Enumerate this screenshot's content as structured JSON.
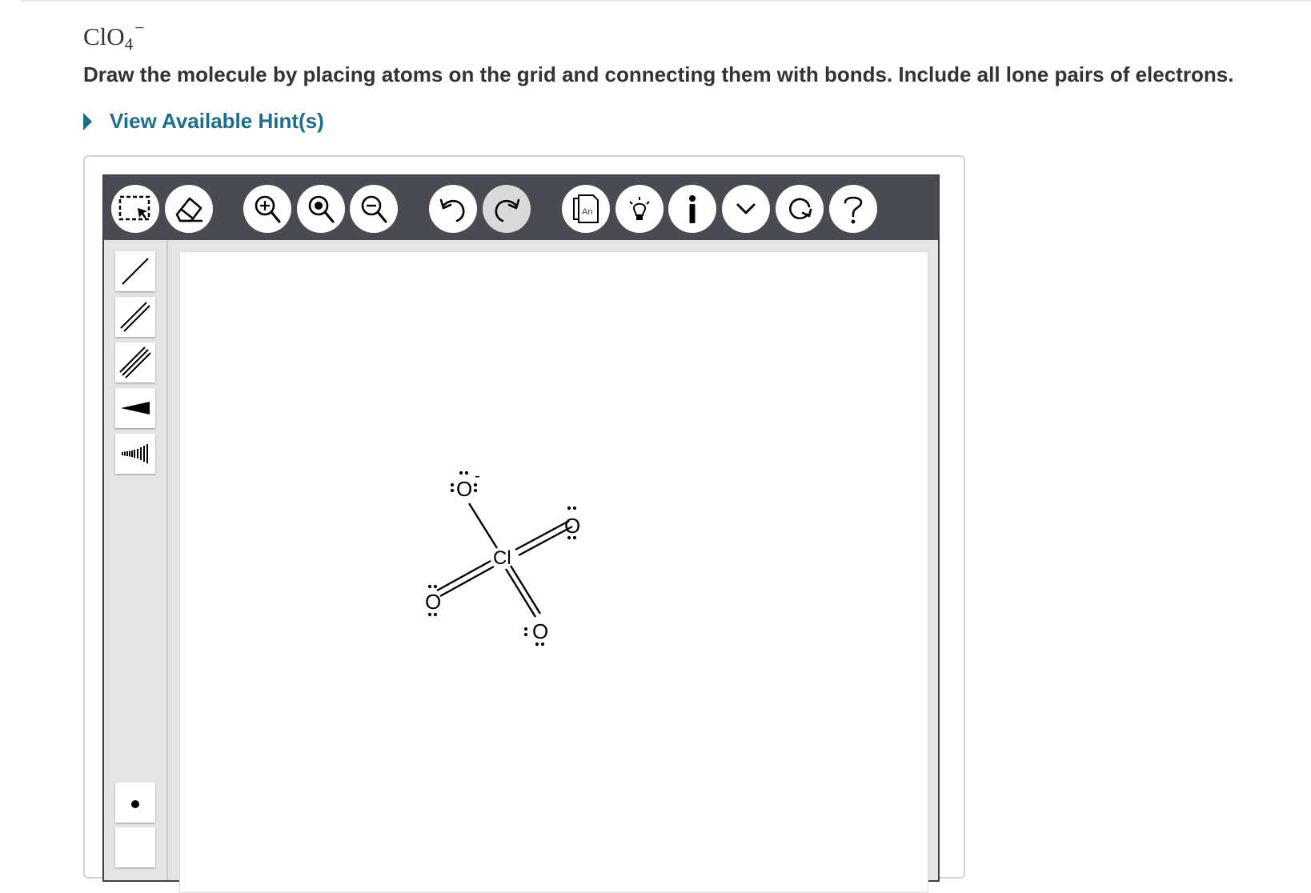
{
  "problem": {
    "formula_base": "ClO",
    "formula_subscript": "4",
    "formula_charge": "−",
    "instructions": "Draw the molecule by placing atoms on the grid and connecting them with bonds. Include all lone pairs of electrons.",
    "hint_link": "View Available Hint(s)"
  },
  "toolbar": {
    "buttons": [
      {
        "name": "marquee-select-icon",
        "enabled": true
      },
      {
        "name": "eraser-icon",
        "enabled": true
      },
      {
        "name": "zoom-in-icon",
        "enabled": true
      },
      {
        "name": "zoom-reset-icon",
        "enabled": true
      },
      {
        "name": "zoom-out-icon",
        "enabled": true
      },
      {
        "name": "undo-icon",
        "enabled": true
      },
      {
        "name": "redo-icon",
        "enabled": false
      },
      {
        "name": "template-icon",
        "enabled": true
      },
      {
        "name": "lightbulb-icon",
        "enabled": true
      },
      {
        "name": "info-icon",
        "enabled": true
      },
      {
        "name": "chevron-down-icon",
        "enabled": true
      },
      {
        "name": "reset-icon",
        "enabled": true
      },
      {
        "name": "help-icon",
        "enabled": true
      }
    ],
    "template_icon_text": "An"
  },
  "sidebar_tools": [
    "single-bond-icon",
    "double-bond-icon",
    "triple-bond-icon",
    "wedge-bond-icon",
    "hash-bond-icon",
    "lone-pair-icon"
  ],
  "molecule": {
    "central_atom": "Cl",
    "outer_atom": "O",
    "charge_label": "-"
  },
  "colors": {
    "toolbar_bg": "#4a4b52",
    "hint_link": "#1a6f8f",
    "text": "#333333"
  }
}
